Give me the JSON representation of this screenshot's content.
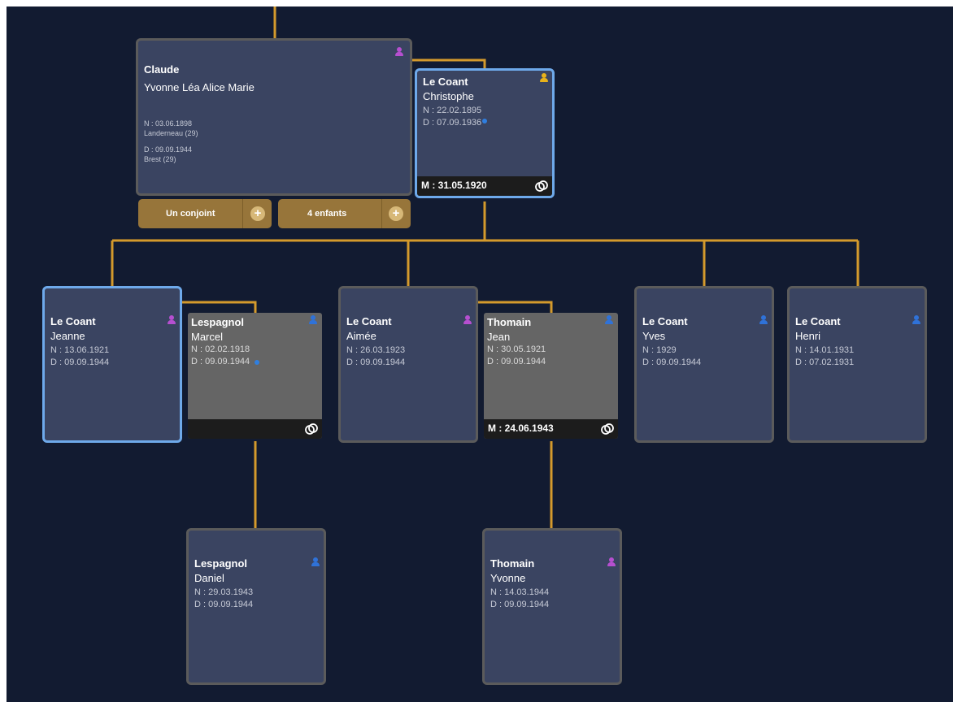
{
  "colors": {
    "background": "#121b31",
    "card": "#3a4461",
    "card_border": "#5b5b5b",
    "selected_border": "#6ea9ea",
    "spouse_card": "#656565",
    "link_line": "#d49a2c",
    "pill": "#97753a",
    "female_icon": "#b64fd0",
    "male_icon": "#2f72d8"
  },
  "claude": {
    "surname": "Claude",
    "given": "Yvonne Léa Alice Marie",
    "birth": "N : 03.06.1898",
    "birth_place": "Landerneau (29)",
    "death": "D : 09.09.1944",
    "death_place": "Brest (29)",
    "gender_icon": "female-person-icon",
    "spouse_button": "Un conjoint",
    "children_button": "4 enfants",
    "plus_symbol": "+"
  },
  "christophe": {
    "surname": "Le Coant",
    "given": "Christophe",
    "birth": "N : 22.02.1895",
    "death": "D : 07.09.1936",
    "marriage": "M : 31.05.1920",
    "gender_icon": "yellow-person-icon"
  },
  "jeanne": {
    "surname": "Le Coant",
    "given": "Jeanne",
    "birth": "N : 13.06.1921",
    "death": "D : 09.09.1944",
    "gender_icon": "female-person-icon"
  },
  "marcel": {
    "surname": "Lespagnol",
    "given": "Marcel",
    "birth": "N : 02.02.1918",
    "death": "D : 09.09.1944",
    "gender_icon": "male-person-icon"
  },
  "aimee": {
    "surname": "Le Coant",
    "given": "Aimée",
    "birth": "N : 26.03.1923",
    "death": "D : 09.09.1944",
    "gender_icon": "female-person-icon"
  },
  "jean": {
    "surname": "Thomain",
    "given": "Jean",
    "birth": "N : 30.05.1921",
    "death": "D : 09.09.1944",
    "marriage": "M : 24.06.1943",
    "gender_icon": "male-person-icon"
  },
  "yves": {
    "surname": "Le Coant",
    "given": "Yves",
    "birth": "N : 1929",
    "death": "D : 09.09.1944",
    "gender_icon": "male-person-icon"
  },
  "henri": {
    "surname": "Le Coant",
    "given": "Henri",
    "birth": "N : 14.01.1931",
    "death": "D : 07.02.1931",
    "gender_icon": "male-person-icon"
  },
  "daniel": {
    "surname": "Lespagnol",
    "given": "Daniel",
    "birth": "N : 29.03.1943",
    "death": "D : 09.09.1944",
    "gender_icon": "male-person-icon"
  },
  "yvonne": {
    "surname": "Thomain",
    "given": "Yvonne",
    "birth": "N : 14.03.1944",
    "death": "D : 09.09.1944",
    "gender_icon": "female-person-icon"
  }
}
